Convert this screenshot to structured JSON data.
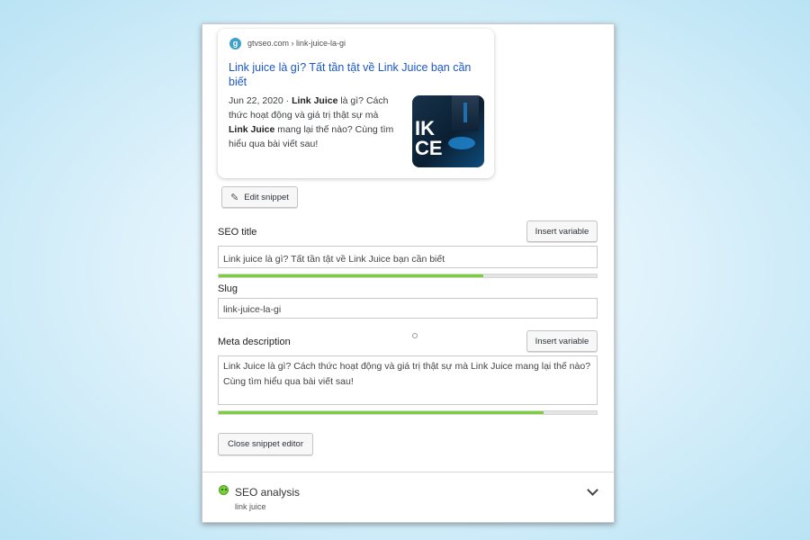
{
  "preview": {
    "favicon_letter": "g",
    "breadcrumb": "gtvseo.com › link-juice-la-gi",
    "title": "Link juice là gì? Tất tần tật về Link Juice bạn cần biết",
    "date": "Jun 22, 2020",
    "desc_part1": "Link Juice",
    "desc_part2": " là gì? Cách thức hoạt động và giá trị thật sự mà ",
    "desc_part3": "Link Juice",
    "desc_part4": " mang lại thế nào? Cùng tìm hiểu qua bài viết sau!",
    "thumb_text_1": "IK",
    "thumb_text_2": "CE"
  },
  "buttons": {
    "edit_snippet": "Edit snippet",
    "insert_variable_title": "Insert variable",
    "insert_variable_meta": "Insert variable",
    "close_snippet": "Close snippet editor"
  },
  "seo_title": {
    "label": "SEO title",
    "value": "Link juice là gì? Tất tần tật về Link Juice bạn cần biết",
    "progress": 0.7
  },
  "slug": {
    "label": "Slug",
    "value": "link-juice-la-gi"
  },
  "meta": {
    "label": "Meta description",
    "value": "Link Juice là gì? Cách thức hoạt động và giá trị thật sự mà Link Juice mang lại thế nào? Cùng tìm hiểu qua bài viết sau!",
    "progress": 0.86
  },
  "analysis": {
    "title": "SEO analysis",
    "keyword": "link juice",
    "status_color": "#7ad03a"
  },
  "colors": {
    "link": "#1a57c7",
    "progress_good": "#7ad03a"
  }
}
